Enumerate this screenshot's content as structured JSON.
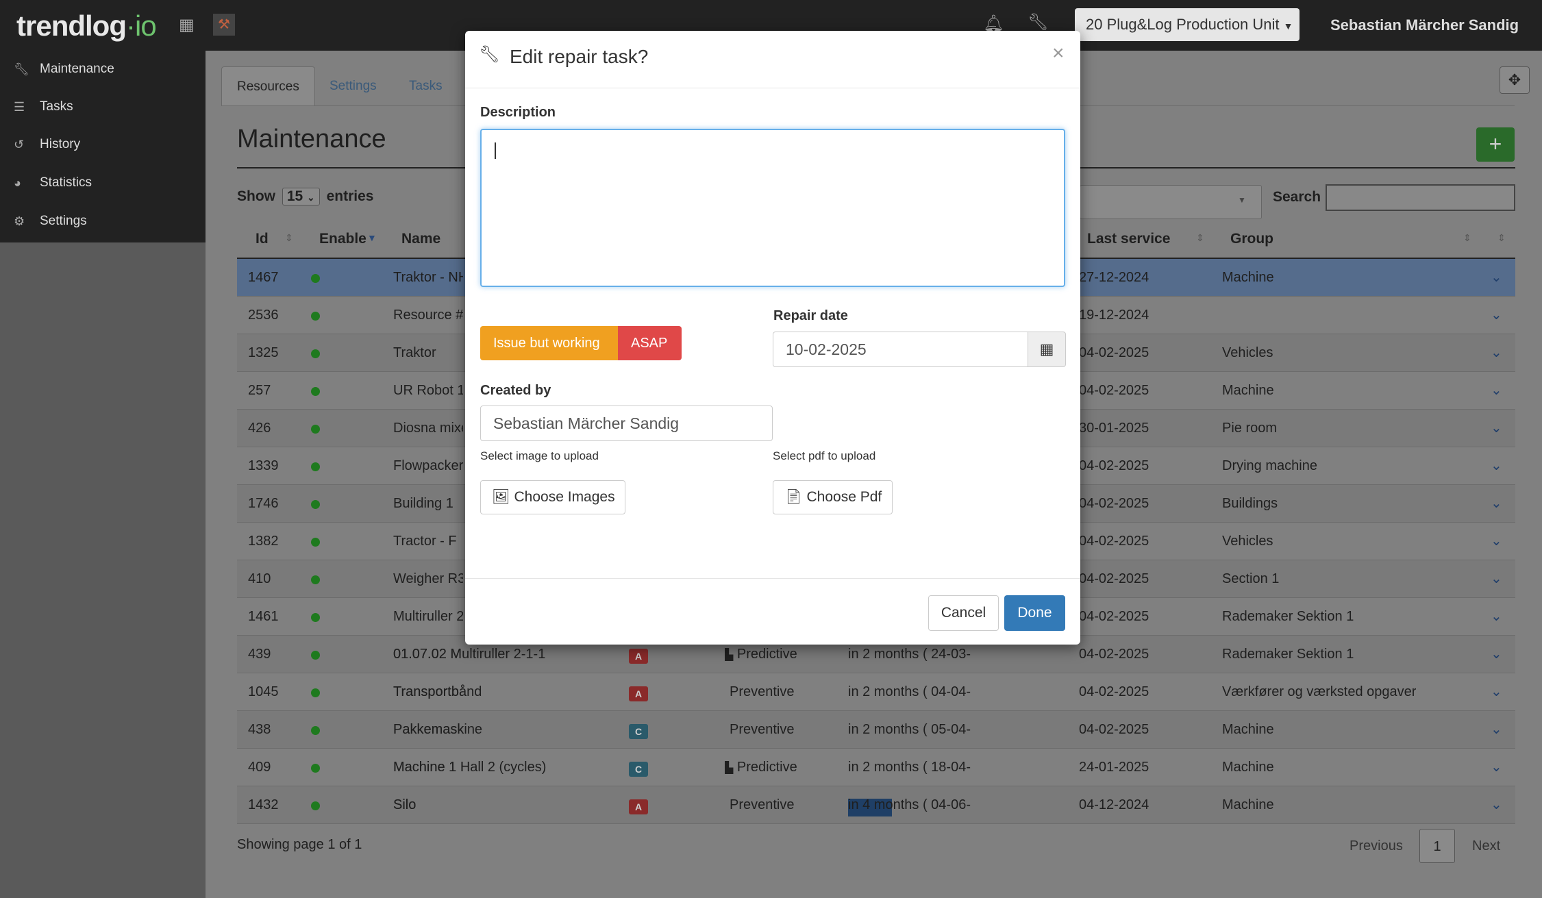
{
  "app": {
    "logo_main": "trendlog",
    "logo_sep": "·",
    "logo_suffix": "io",
    "unit_label": "20 Plug&Log Production Unit",
    "user_name": "Sebastian Märcher Sandig"
  },
  "icons": {
    "grid": "grid-icon",
    "tool": "tool-icon",
    "bell": "bell-icon",
    "wrench": "wrench-icon"
  },
  "sidebar": {
    "items": [
      {
        "label": "Maintenance",
        "icon": "wrench-icon"
      },
      {
        "label": "Tasks",
        "icon": "list-icon"
      },
      {
        "label": "History",
        "icon": "history-icon"
      },
      {
        "label": "Statistics",
        "icon": "pie-icon"
      },
      {
        "label": "Settings",
        "icon": "gear-icon"
      }
    ]
  },
  "tabs": [
    "Resources",
    "Settings",
    "Tasks"
  ],
  "page": {
    "title": "Maintenance",
    "show_label": "Show",
    "show_value": "15",
    "entries_label": "entries",
    "search_label": "Search"
  },
  "columns": {
    "id": "Id",
    "enable": "Enable",
    "name": "Name",
    "last_service": "Last service",
    "group": "Group"
  },
  "rows": [
    {
      "id": "1467",
      "name": "Traktor - NH",
      "badge": "",
      "type": "",
      "due": "",
      "last": "27-12-2024",
      "group": "Machine"
    },
    {
      "id": "2536",
      "name": "Resource #",
      "badge": "",
      "type": "",
      "due": "",
      "last": "19-12-2024",
      "group": ""
    },
    {
      "id": "1325",
      "name": "Traktor",
      "badge": "",
      "type": "",
      "due": "",
      "last": "04-02-2025",
      "group": "Vehicles"
    },
    {
      "id": "257",
      "name": "UR Robot 1",
      "badge": "",
      "type": "",
      "due": "",
      "last": "04-02-2025",
      "group": "Machine"
    },
    {
      "id": "426",
      "name": "Diosna mixe",
      "badge": "",
      "type": "",
      "due": "",
      "last": "30-01-2025",
      "group": "Pie room"
    },
    {
      "id": "1339",
      "name": "Flowpacker",
      "badge": "",
      "type": "",
      "due": "",
      "last": "04-02-2025",
      "group": "Drying machine"
    },
    {
      "id": "1746",
      "name": "Building 1",
      "badge": "",
      "type": "",
      "due": "",
      "last": "04-02-2025",
      "group": "Buildings"
    },
    {
      "id": "1382",
      "name": "Tractor - F",
      "badge": "",
      "type": "",
      "due": "",
      "last": "04-02-2025",
      "group": "Vehicles"
    },
    {
      "id": "410",
      "name": "Weigher R3",
      "badge": "",
      "type": "",
      "due": "",
      "last": "04-02-2025",
      "group": "Section 1"
    },
    {
      "id": "1461",
      "name": "Multiruller 2",
      "badge": "",
      "type": "",
      "due": "",
      "last": "04-02-2025",
      "group": "Rademaker Sektion 1"
    },
    {
      "id": "439",
      "name": "01.07.02 Multiruller 2-1-1",
      "badge": "A",
      "type": "Predictive",
      "due": "in 2 months ( 24-03-",
      "last": "04-02-2025",
      "group": "Rademaker Sektion 1"
    },
    {
      "id": "1045",
      "name": "Transportbånd",
      "badge": "A",
      "type": "Preventive",
      "due": "in 2 months ( 04-04-",
      "last": "04-02-2025",
      "group": "Værkfører og værksted opgaver"
    },
    {
      "id": "438",
      "name": "Pakkemaskine",
      "badge": "C",
      "type": "Preventive",
      "due": "in 2 months ( 05-04-",
      "last": "04-02-2025",
      "group": "Machine"
    },
    {
      "id": "409",
      "name": "Machine 1 Hall 2 (cycles)",
      "badge": "C",
      "type": "Predictive",
      "due": "in 2 months ( 18-04-",
      "last": "24-01-2025",
      "group": "Machine"
    },
    {
      "id": "1432",
      "name": "Silo",
      "badge": "A",
      "type": "Preventive",
      "due": "in 4 months ( 04-06-",
      "last": "04-12-2024",
      "group": "Machine"
    }
  ],
  "footer": {
    "showing": "Showing page 1 of 1",
    "previous": "Previous",
    "page": "1",
    "next": "Next"
  },
  "modal": {
    "title": "Edit repair task?",
    "close": "×",
    "description_label": "Description",
    "description_value": "",
    "priority_warn": "Issue but working",
    "priority_asap": "ASAP",
    "repair_date_label": "Repair date",
    "repair_date_value": "10-02-2025",
    "created_by_label": "Created by",
    "created_by_value": "Sebastian Märcher Sandig",
    "image_upload_label": "Select image to upload",
    "pdf_upload_label": "Select pdf to upload",
    "choose_images": "Choose Images",
    "choose_pdf": "Choose Pdf",
    "cancel": "Cancel",
    "done": "Done"
  }
}
